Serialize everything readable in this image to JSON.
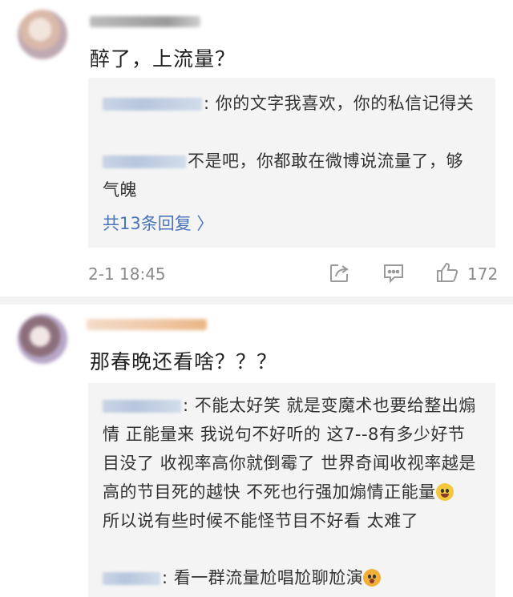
{
  "comments": [
    {
      "text": "醉了，上流量？",
      "replies": [
        {
          "text": ": 你的文字我喜欢，你的私信记得关"
        },
        {
          "text": "不是吧，你都敢在微博说流量了，够气魄"
        }
      ],
      "more_label": "共13条回复 〉",
      "timestamp": "2-1 18:45",
      "like_count": "172"
    },
    {
      "text": "那春晚还看啥？？？",
      "replies": [
        {
          "text": ": 不能太好笑   就是变魔术也要给整出煽情 正能量来   我说句不好听的  这7--8有多少好节目没了  收视率高你就倒霉了   世界奇闻收视率越是高的节目死的越快   不死也行强加煽情正能量"
        },
        {
          "text": "所以说有些时候不能怪节目不好看    太难了"
        },
        {
          "text": ": 看一群流量尬唱尬聊尬演"
        }
      ]
    }
  ],
  "icons": {
    "share": "share-icon",
    "comment": "comment-icon",
    "like": "thumbs-up-icon"
  },
  "colors": {
    "link": "#4a74b7",
    "reply_bg": "#f4f4f4",
    "meta": "#8a8a8a"
  }
}
